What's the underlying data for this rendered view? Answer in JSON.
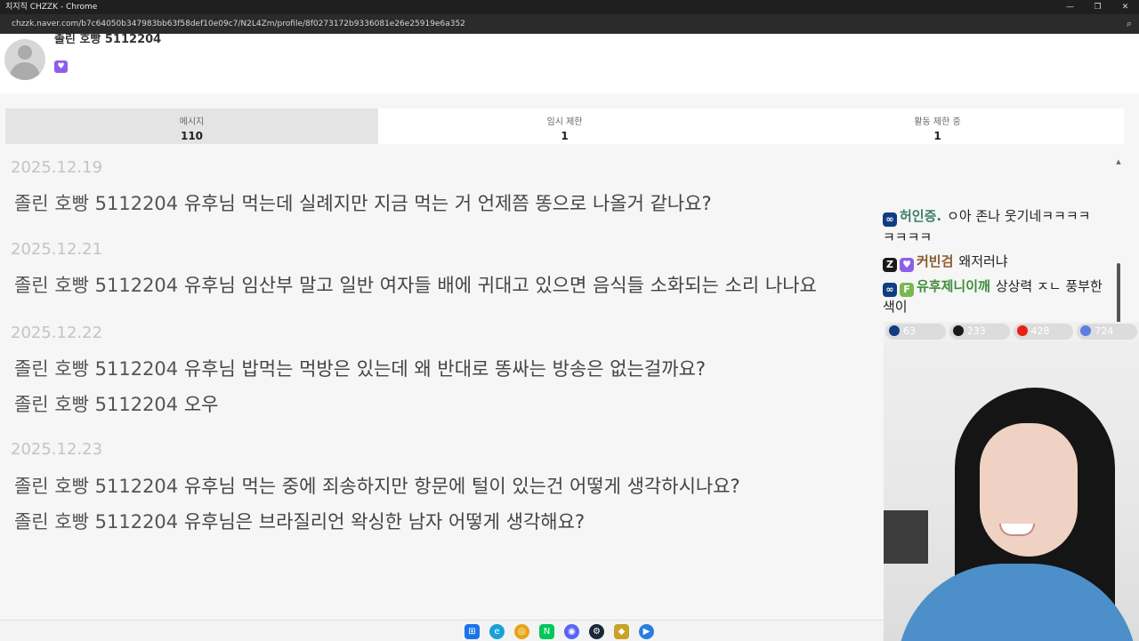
{
  "browser": {
    "window_title": "치지직 CHZZK - Chrome",
    "url": "chzzk.naver.com/b7c64050b347983bb63f58def10e09c7/N2L4Zm/profile/8f0273172b9336081e26e25919e6a352",
    "controls": {
      "minimize": "—",
      "restore": "❐",
      "close": "✕"
    },
    "zoom_icon": "zoom-icon"
  },
  "profile": {
    "nickname": "졸린 호빵 5112204",
    "badge_icon": "heart-badge-icon"
  },
  "tabs": [
    {
      "label": "메시지",
      "count": "110"
    },
    {
      "label": "임시 제한",
      "count": "1"
    },
    {
      "label": "활동 제한 중",
      "count": "1"
    }
  ],
  "messages": [
    {
      "date": "2025.12.19",
      "lines": [
        {
          "user": "졸린 호빵 5112204",
          "text": "유후님 먹는데 실례지만 지금 먹는 거 언제쯤 똥으로 나올거 같나요?"
        }
      ]
    },
    {
      "date": "2025.12.21",
      "lines": [
        {
          "user": "졸린 호빵 5112204",
          "text": "유후님 임산부 말고 일반 여자들 배에 귀대고 있으면 음식들 소화되는 소리 나나요"
        }
      ]
    },
    {
      "date": "2025.12.22",
      "lines": [
        {
          "user": "졸린 호빵 5112204",
          "text": "유후님 밥먹는 먹방은 있는데 왜 반대로 똥싸는 방송은 없는걸까요?"
        },
        {
          "user": "졸린 호빵 5112204",
          "text": "오우"
        }
      ]
    },
    {
      "date": "2025.12.23",
      "lines": [
        {
          "user": "졸린 호빵 5112204",
          "text": "유후님 먹는 중에 죄송하지만 항문에 털이 있는건 어떻게 생각하시나요?"
        },
        {
          "user": "졸린 호빵 5112204",
          "text": "유후님은 브라질리언 왁싱한 남자 어떻게 생각해요?"
        }
      ]
    }
  ],
  "chat": [
    {
      "name": "허인증.",
      "text": "ㅇ아 존나 웃기네ㅋㅋㅋㅋ",
      "cont": "ㅋㅋㅋㅋ"
    },
    {
      "name": "커빈검",
      "text": "왜저러냐"
    },
    {
      "name": "유후제니이깨",
      "text": "상상력 ㅈㄴ 풍부한",
      "cont": "색이"
    }
  ],
  "viewer_counts": [
    {
      "platform": "chzzk",
      "count": "63",
      "color": "#0f3d82"
    },
    {
      "platform": "z",
      "count": "233",
      "color": "#1a1a1a"
    },
    {
      "platform": "youtube",
      "count": "428",
      "color": "#e62117"
    },
    {
      "platform": "other",
      "count": "724",
      "color": "#5b7fe0"
    }
  ],
  "taskbar": {
    "icons": [
      "windows-start-icon",
      "edge-icon",
      "chrome-icon",
      "naver-icon",
      "discord-icon",
      "steam-icon",
      "app-icon",
      "media-icon"
    ]
  }
}
